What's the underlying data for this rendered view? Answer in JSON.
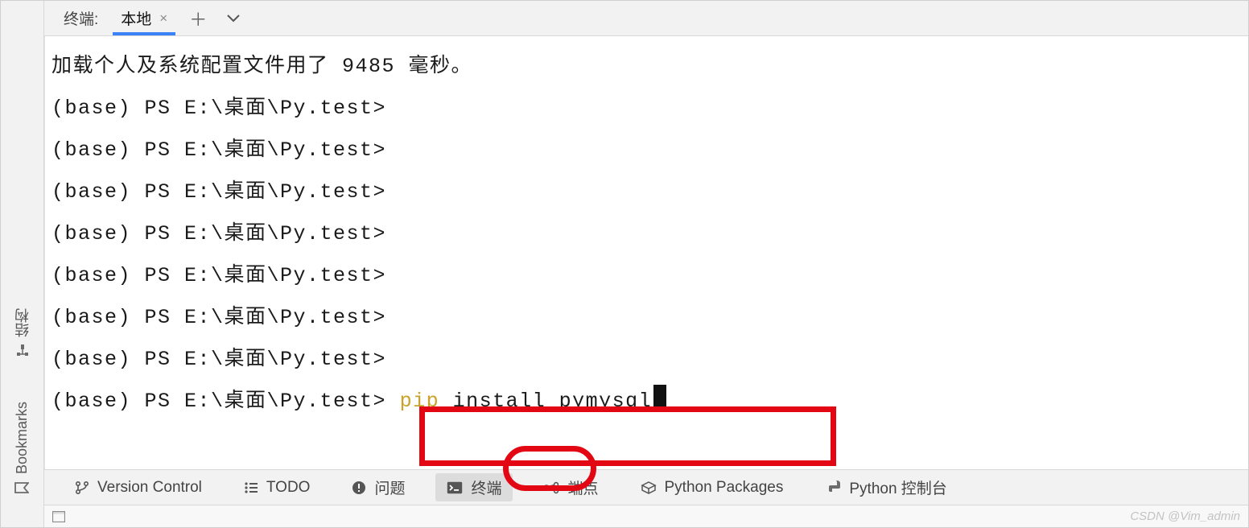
{
  "panel": {
    "title": "终端:",
    "tab_label": "本地"
  },
  "side": {
    "structure": "结构",
    "bookmarks": "Bookmarks"
  },
  "terminal": {
    "load_msg_prefix": "加载个人及系统配置文件用了 ",
    "load_ms": "9485",
    "load_msg_suffix": " 毫秒。",
    "prompt": "(base) PS E:\\桌面\\Py.test>",
    "cmd_pip": "pip",
    "cmd_rest": " install pymysql"
  },
  "tools": {
    "vcs": "Version Control",
    "todo": "TODO",
    "problems": "问题",
    "terminal": "终端",
    "endpoints": "端点",
    "pypkg": "Python Packages",
    "pyconsole": "Python 控制台"
  },
  "watermark": "CSDN @Vim_admin"
}
